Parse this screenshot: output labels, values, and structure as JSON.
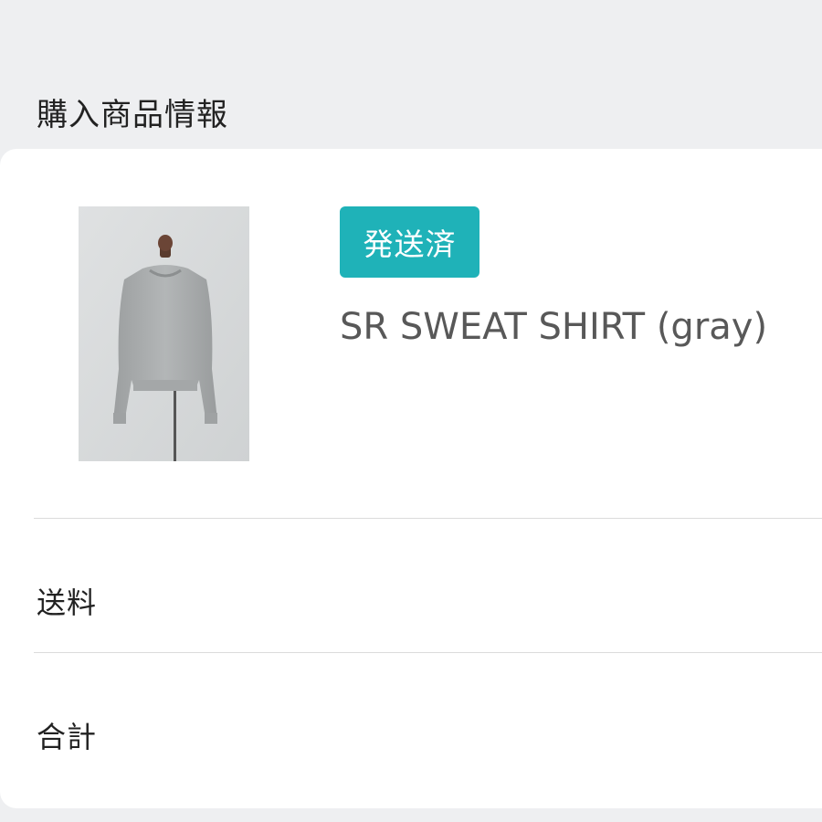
{
  "section": {
    "title": "購入商品情報"
  },
  "product": {
    "status": "発送済",
    "status_color": "#1fb2b8",
    "name": "SR SWEAT SHIRT (gray)",
    "image_icon": "gray-sweatshirt-on-mannequin-image"
  },
  "summary": {
    "shipping_label": "送料",
    "total_label": "合計"
  }
}
